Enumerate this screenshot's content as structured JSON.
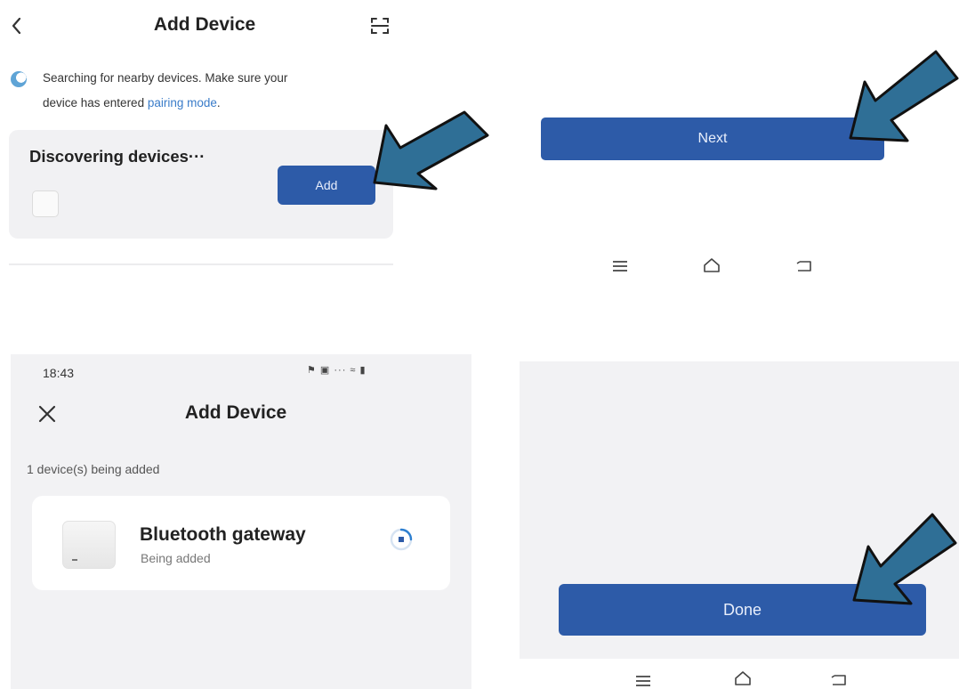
{
  "panel1": {
    "title": "Add Device",
    "message_line1": "Searching for nearby devices. Make sure your",
    "message_line2_prefix": "device has entered ",
    "message_link": "pairing mode",
    "message_line2_suffix": ".",
    "card_title": "Discovering devices···",
    "add_label": "Add",
    "icons": [
      "back-icon",
      "scan-icon",
      "spinner-icon"
    ]
  },
  "panel2": {
    "next_label": "Next",
    "nav_icons": [
      "menu-icon",
      "home-icon",
      "back-nav-icon"
    ]
  },
  "panel3": {
    "time": "18:43",
    "status_icons": "⚑ ▣ ··· ≈ ▮",
    "title": "Add Device",
    "count_text": "1 device(s) being added",
    "device_name": "Bluetooth gateway",
    "device_status": "Being added",
    "icons": [
      "close-icon",
      "device-thumb",
      "loading-icon"
    ]
  },
  "panel4": {
    "done_label": "Done",
    "nav_icons": [
      "menu-icon",
      "home-icon",
      "back-nav-icon"
    ]
  },
  "colors": {
    "primary": "#2d5ba8",
    "arrow": "#2f6f96",
    "card_bg": "#f1f1f3",
    "link": "#3a7cc9"
  }
}
